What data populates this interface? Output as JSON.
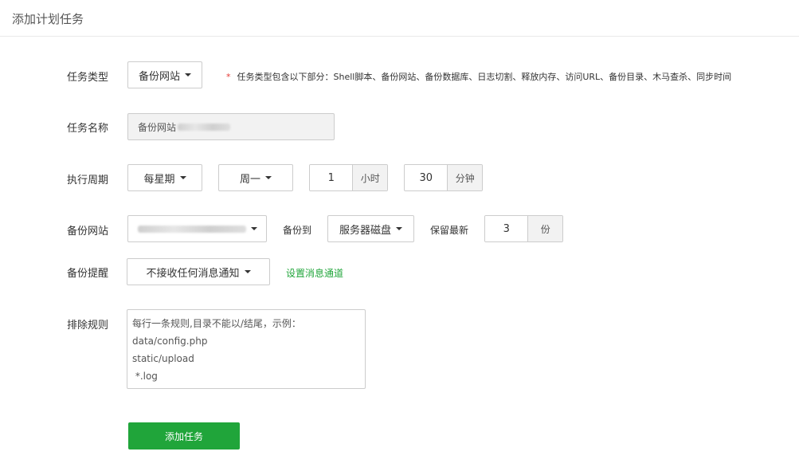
{
  "header": {
    "title": "添加计划任务"
  },
  "form": {
    "task_type": {
      "label": "任务类型",
      "value": "备份网站",
      "hint_star": "*",
      "hint": "任务类型包含以下部分：Shell脚本、备份网站、备份数据库、日志切割、释放内存、访问URL、备份目录、木马查杀、同步时间"
    },
    "task_name": {
      "label": "任务名称",
      "value": "备份网站"
    },
    "period": {
      "label": "执行周期",
      "frequency": "每星期",
      "weekday": "周一",
      "hour": "1",
      "hour_unit": "小时",
      "minute": "30",
      "minute_unit": "分钟"
    },
    "site": {
      "label": "备份网站",
      "backup_to_label": "备份到",
      "backup_to": "服务器磁盘",
      "retain_label": "保留最新",
      "retain": "3",
      "retain_unit": "份"
    },
    "reminder": {
      "label": "备份提醒",
      "value": "不接收任何消息通知",
      "link": "设置消息通道"
    },
    "exclude": {
      "label": "排除规则",
      "lines": [
        "每行一条规则,目录不能以/结尾，示例：",
        "data/config.php",
        "static/upload",
        " *.log"
      ]
    },
    "submit": "添加任务"
  },
  "colors": {
    "accent": "#20a53a",
    "required": "#e53935"
  }
}
